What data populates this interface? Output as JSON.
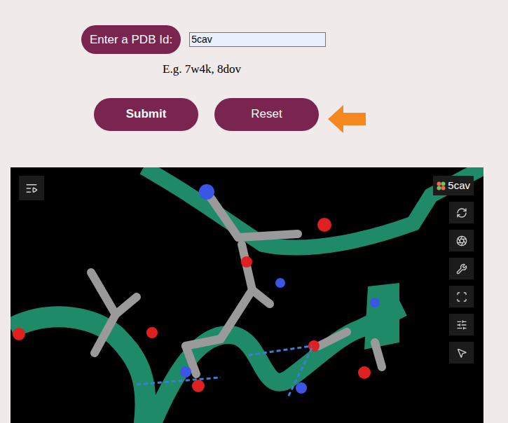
{
  "form": {
    "label": "Enter a PDB Id:",
    "input": {
      "value": "5cav"
    },
    "hint": "E.g. 7w4k, 8dov"
  },
  "buttons": [
    {
      "label": "Submit",
      "bold": true,
      "marked": false
    },
    {
      "label": "Reset",
      "bold": false,
      "marked": true
    }
  ],
  "viewer": {
    "title": "5cav"
  }
}
